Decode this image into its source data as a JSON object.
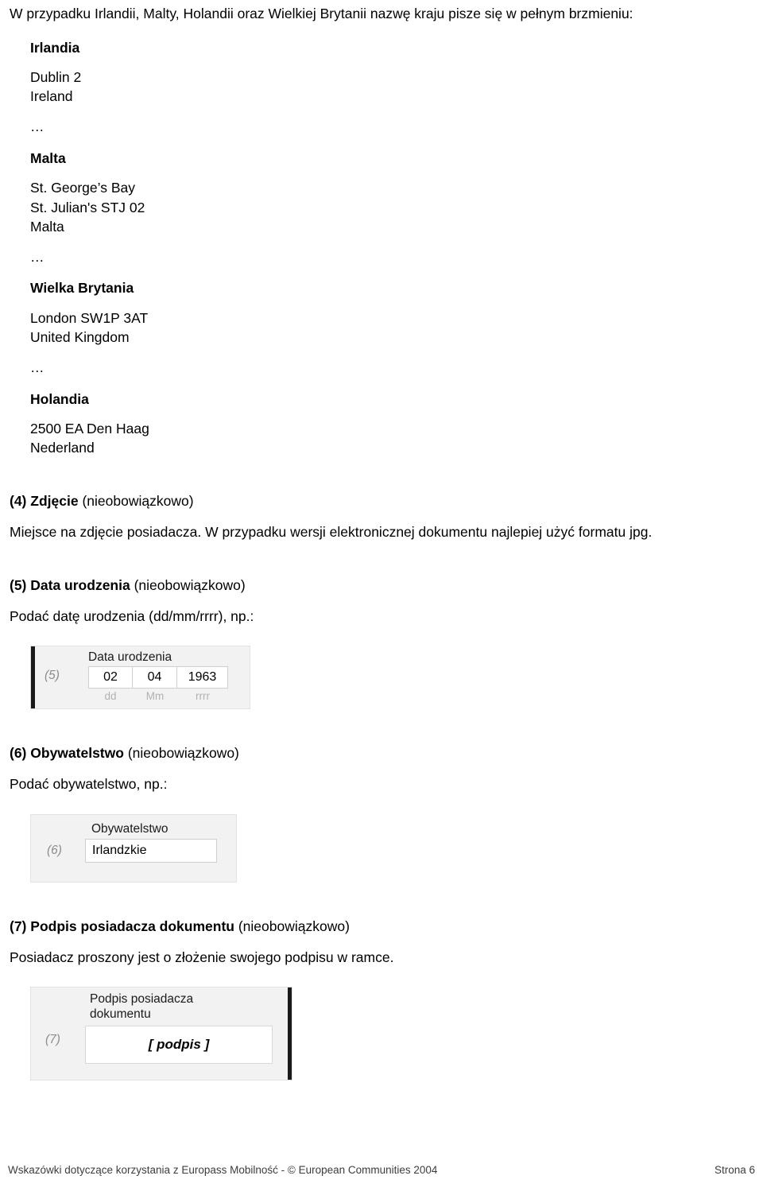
{
  "intro": "W przypadku Irlandii, Malty, Holandii oraz Wielkiej Brytanii nazwę kraju pisze się w pełnym brzmieniu:",
  "ellipsis": "…",
  "addresses": [
    {
      "country": "Irlandia",
      "lines": [
        "Dublin 2",
        "Ireland"
      ]
    },
    {
      "country": "Malta",
      "lines": [
        "St. George’s Bay",
        "St. Julian's STJ 02",
        "Malta"
      ]
    },
    {
      "country": "Wielka Brytania",
      "lines": [
        "London SW1P 3AT",
        "United Kingdom"
      ]
    },
    {
      "country": "Holandia",
      "lines": [
        "2500 EA Den Haag",
        "Nederland"
      ]
    }
  ],
  "sections": {
    "photo": {
      "number": "(4)",
      "title": "Zdjęcie",
      "optional": "(nieobowiązkowo)",
      "body": "Miejsce na zdjęcie posiadacza. W przypadku wersji elektronicznej dokumentu najlepiej użyć formatu jpg."
    },
    "birthdate": {
      "number": "(5)",
      "title": "Data urodzenia",
      "optional": "(nieobowiązkowo)",
      "body": "Podać datę urodzenia (dd/mm/rrrr), np.:",
      "box": {
        "tag": "(5)",
        "header": "Data urodzenia",
        "day": "02",
        "month": "04",
        "year": "1963",
        "hint_day": "dd",
        "hint_month": "Mm",
        "hint_year": "rrrr"
      }
    },
    "citizenship": {
      "number": "(6)",
      "title": "Obywatelstwo",
      "optional": "(nieobowiązkowo)",
      "body": "Podać obywatelstwo, np.:",
      "box": {
        "tag": "(6)",
        "header": "Obywatelstwo",
        "value": "Irlandzkie"
      }
    },
    "signature": {
      "number": "(7)",
      "title": "Podpis posiadacza dokumentu",
      "optional": "(nieobowiązkowo)",
      "body": "Posiadacz proszony jest o złożenie swojego podpisu w ramce.",
      "box": {
        "tag": "(7)",
        "header": "Podpis posiadacza dokumentu",
        "value": "[ podpis ]"
      }
    }
  },
  "footer": {
    "left": "Wskazówki dotyczące korzystania z Europass Mobilność  -  © European Communities 2004",
    "right": "Strona 6"
  },
  "colors": {
    "box_background": "#f2f2f2",
    "box_border": "#e2e2e2",
    "side_bar": "#1a1a1a",
    "hint_text": "#b2b2b2",
    "tag_text": "#8c8c8c",
    "input_border": "#cfcfcf",
    "text": "#000000"
  }
}
